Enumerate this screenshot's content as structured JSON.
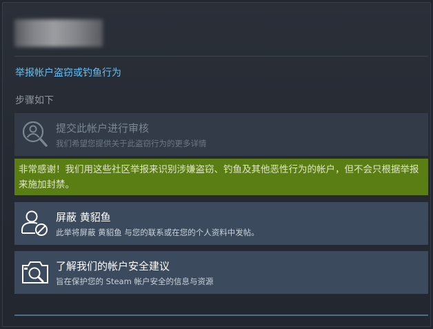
{
  "header": {
    "report_link": "举报帐户盗窃或钓鱼行为",
    "steps_label": "步骤如下"
  },
  "options": [
    {
      "icon": "search-user-icon",
      "title": "提交此帐户进行审核",
      "description": "我们希望您提供关于此盗窃行为的更多详情",
      "state": "disabled"
    },
    {
      "icon": "block-user-icon",
      "title": "屏蔽 黄貂鱼",
      "description": "此举将屏蔽 黄貂鱼 与您的联系或在您的个人资料中发帖。",
      "state": "enabled"
    },
    {
      "icon": "security-tips-icon",
      "title": "了解我们的帐户安全建议",
      "description": "旨在保护您的 Steam 帐户安全的信息与资源",
      "state": "enabled"
    }
  ],
  "notice": {
    "text": "非常感谢！我们用这些社区举报来识别涉嫌盗窃、钓鱼及其他恶性行为的帐户，但不会只根据举报来施加封禁。",
    "color": "#5a7d14"
  },
  "colors": {
    "link": "#66c0f4",
    "option_bg": "#3b4a5c",
    "background": "#23272f"
  }
}
